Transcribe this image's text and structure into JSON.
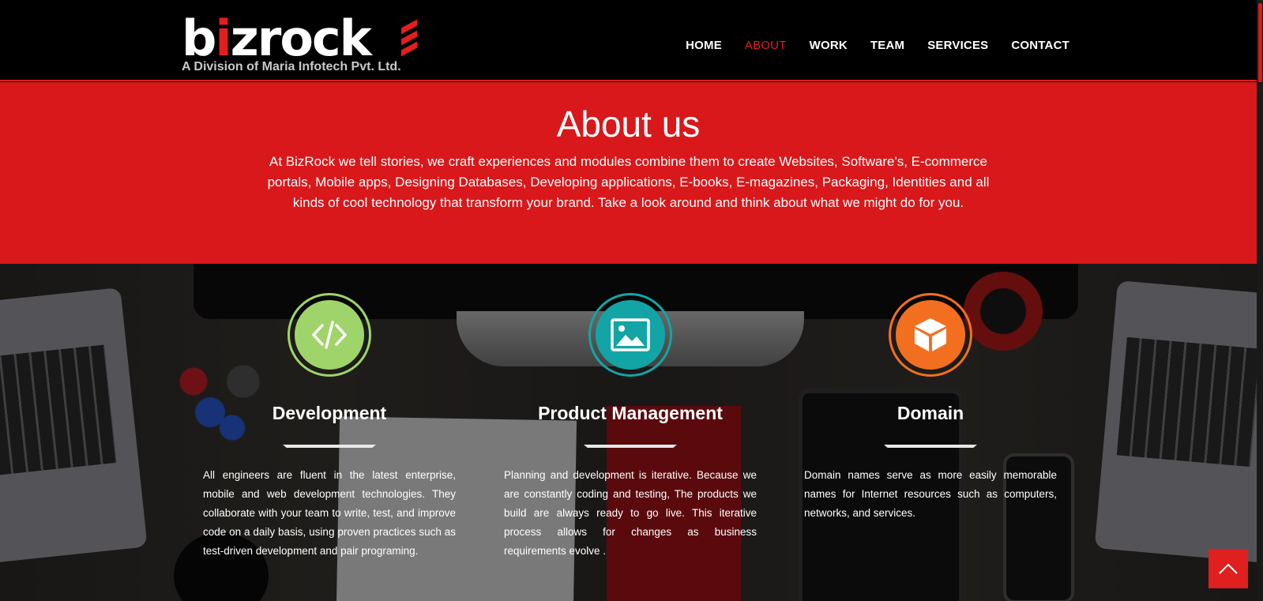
{
  "brand": {
    "logo_word_start": "b",
    "logo_word_i": "i",
    "logo_word_end": "zrock",
    "tagline": "A Division of Maria Infotech Pvt. Ltd."
  },
  "nav": {
    "items": [
      {
        "label": "HOME",
        "active": false
      },
      {
        "label": "ABOUT",
        "active": true
      },
      {
        "label": "WORK",
        "active": false
      },
      {
        "label": "TEAM",
        "active": false
      },
      {
        "label": "SERVICES",
        "active": false
      },
      {
        "label": "CONTACT",
        "active": false
      }
    ]
  },
  "about": {
    "title": "About us",
    "text": "At BizRock we tell stories, we craft experiences and modules combine them to create Websites, Software's, E-commerce portals, Mobile apps, Designing Databases, Developing applications, E-books, E-magazines, Packaging, Identities and all kinds of cool technology that transform your brand. Take a look around and think about what we might do for you."
  },
  "services": [
    {
      "icon": "code-icon",
      "title": "Development",
      "text": "All engineers are fluent in the latest enterprise, mobile and web development technologies. They collaborate with your team to write, test, and improve code on a daily basis, using proven practices such as test-driven development and pair programing."
    },
    {
      "icon": "image-icon",
      "title": "Product Management",
      "text": "Planning and development is iterative. Because we are constantly coding and testing, The products we build are always ready to go live. This iterative process allows for changes as business requirements evolve ."
    },
    {
      "icon": "cube-icon",
      "title": "Domain",
      "text": "Domain names serve as more easily memorable names for Internet resources such as computers, networks, and services."
    }
  ],
  "colors": {
    "brand_red": "#d8181b",
    "development": "#9fd46a",
    "product_management": "#13a5a5",
    "domain": "#f36f20"
  },
  "back_to_top": {
    "icon": "chevron-up-icon"
  }
}
